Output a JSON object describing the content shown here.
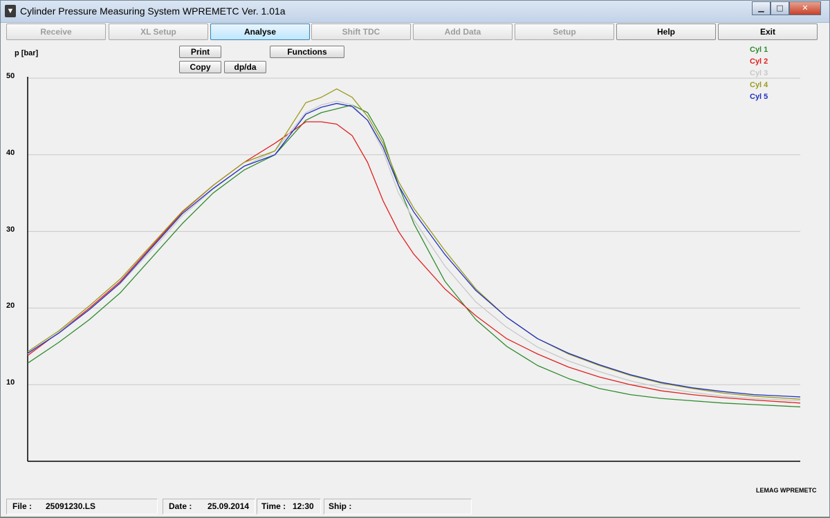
{
  "window": {
    "title": "Cylinder Pressure Measuring System WPREMETC Ver. 1.01a",
    "controls": {
      "min": "▁",
      "max": "□",
      "close": "✕"
    }
  },
  "toolbar": {
    "receive": "Receive",
    "xl_setup": "XL Setup",
    "analyse": "Analyse",
    "shift_tdc": "Shift TDC",
    "add_data": "Add Data",
    "setup": "Setup",
    "help": "Help",
    "exit": "Exit"
  },
  "chart_tools": {
    "print": "Print",
    "functions": "Functions",
    "copy": "Copy",
    "dpda": "dp/da"
  },
  "brand_text": "LEMAG WPREMETC",
  "status": {
    "file_label": "File :",
    "file_value": "25091230.LS",
    "date_label": "Date :",
    "date_value": "25.09.2014",
    "time_label": "Time :",
    "time_value": "12:30",
    "ship_label": "Ship :",
    "ship_value": ""
  },
  "chart_data": {
    "type": "line",
    "ylabel": "p [bar]",
    "xlabel": "",
    "ylim": [
      0,
      50
    ],
    "yticks": [
      10,
      20,
      30,
      40,
      50
    ],
    "grid": true,
    "legend_position": "top-right",
    "x": [
      0,
      4,
      8,
      12,
      16,
      20,
      24,
      28,
      32,
      36,
      38,
      40,
      42,
      44,
      46,
      48,
      50,
      54,
      58,
      62,
      66,
      70,
      74,
      78,
      82,
      86,
      90,
      94,
      100
    ],
    "series": [
      {
        "name": "Cyl 1",
        "color": "#2e8b2e",
        "values": [
          12.8,
          15.5,
          18.5,
          22.0,
          26.5,
          31.0,
          35.0,
          38.0,
          40.0,
          44.5,
          45.5,
          46.0,
          46.5,
          45.5,
          42.0,
          36.0,
          31.0,
          23.5,
          18.5,
          15.0,
          12.5,
          10.8,
          9.5,
          8.7,
          8.2,
          7.9,
          7.6,
          7.4,
          7.1
        ]
      },
      {
        "name": "Cyl 2",
        "color": "#e02020",
        "values": [
          13.8,
          16.8,
          20.0,
          23.5,
          28.0,
          32.5,
          36.0,
          39.0,
          41.5,
          44.3,
          44.3,
          44.0,
          42.5,
          39.0,
          34.0,
          30.0,
          27.0,
          22.5,
          19.0,
          16.0,
          14.0,
          12.3,
          11.0,
          10.0,
          9.2,
          8.7,
          8.3,
          8.0,
          7.6
        ]
      },
      {
        "name": "Cyl 3",
        "color": "#c8c8c8",
        "values": [
          14.0,
          16.8,
          19.8,
          23.2,
          27.5,
          32.0,
          35.5,
          38.5,
          40.5,
          45.5,
          46.5,
          47.0,
          46.5,
          44.5,
          40.5,
          35.0,
          31.5,
          25.5,
          20.8,
          17.5,
          14.9,
          13.1,
          11.7,
          10.5,
          9.6,
          9.0,
          8.5,
          8.2,
          7.9
        ]
      },
      {
        "name": "Cyl 4",
        "color": "#9a9a1e",
        "values": [
          14.3,
          17.0,
          20.3,
          23.8,
          28.2,
          32.6,
          36.0,
          39.0,
          40.5,
          46.8,
          47.5,
          48.6,
          47.5,
          45.0,
          41.5,
          36.5,
          33.0,
          27.5,
          22.5,
          18.8,
          16.0,
          14.0,
          12.5,
          11.2,
          10.2,
          9.5,
          8.9,
          8.5,
          8.1
        ]
      },
      {
        "name": "Cyl 5",
        "color": "#2030c0",
        "values": [
          14.1,
          16.7,
          19.8,
          23.3,
          27.8,
          32.3,
          35.6,
          38.5,
          40.0,
          45.3,
          46.2,
          46.7,
          46.3,
          44.5,
          41.0,
          36.0,
          32.5,
          27.0,
          22.3,
          18.8,
          16.0,
          14.1,
          12.6,
          11.3,
          10.3,
          9.6,
          9.1,
          8.7,
          8.4
        ]
      }
    ]
  }
}
